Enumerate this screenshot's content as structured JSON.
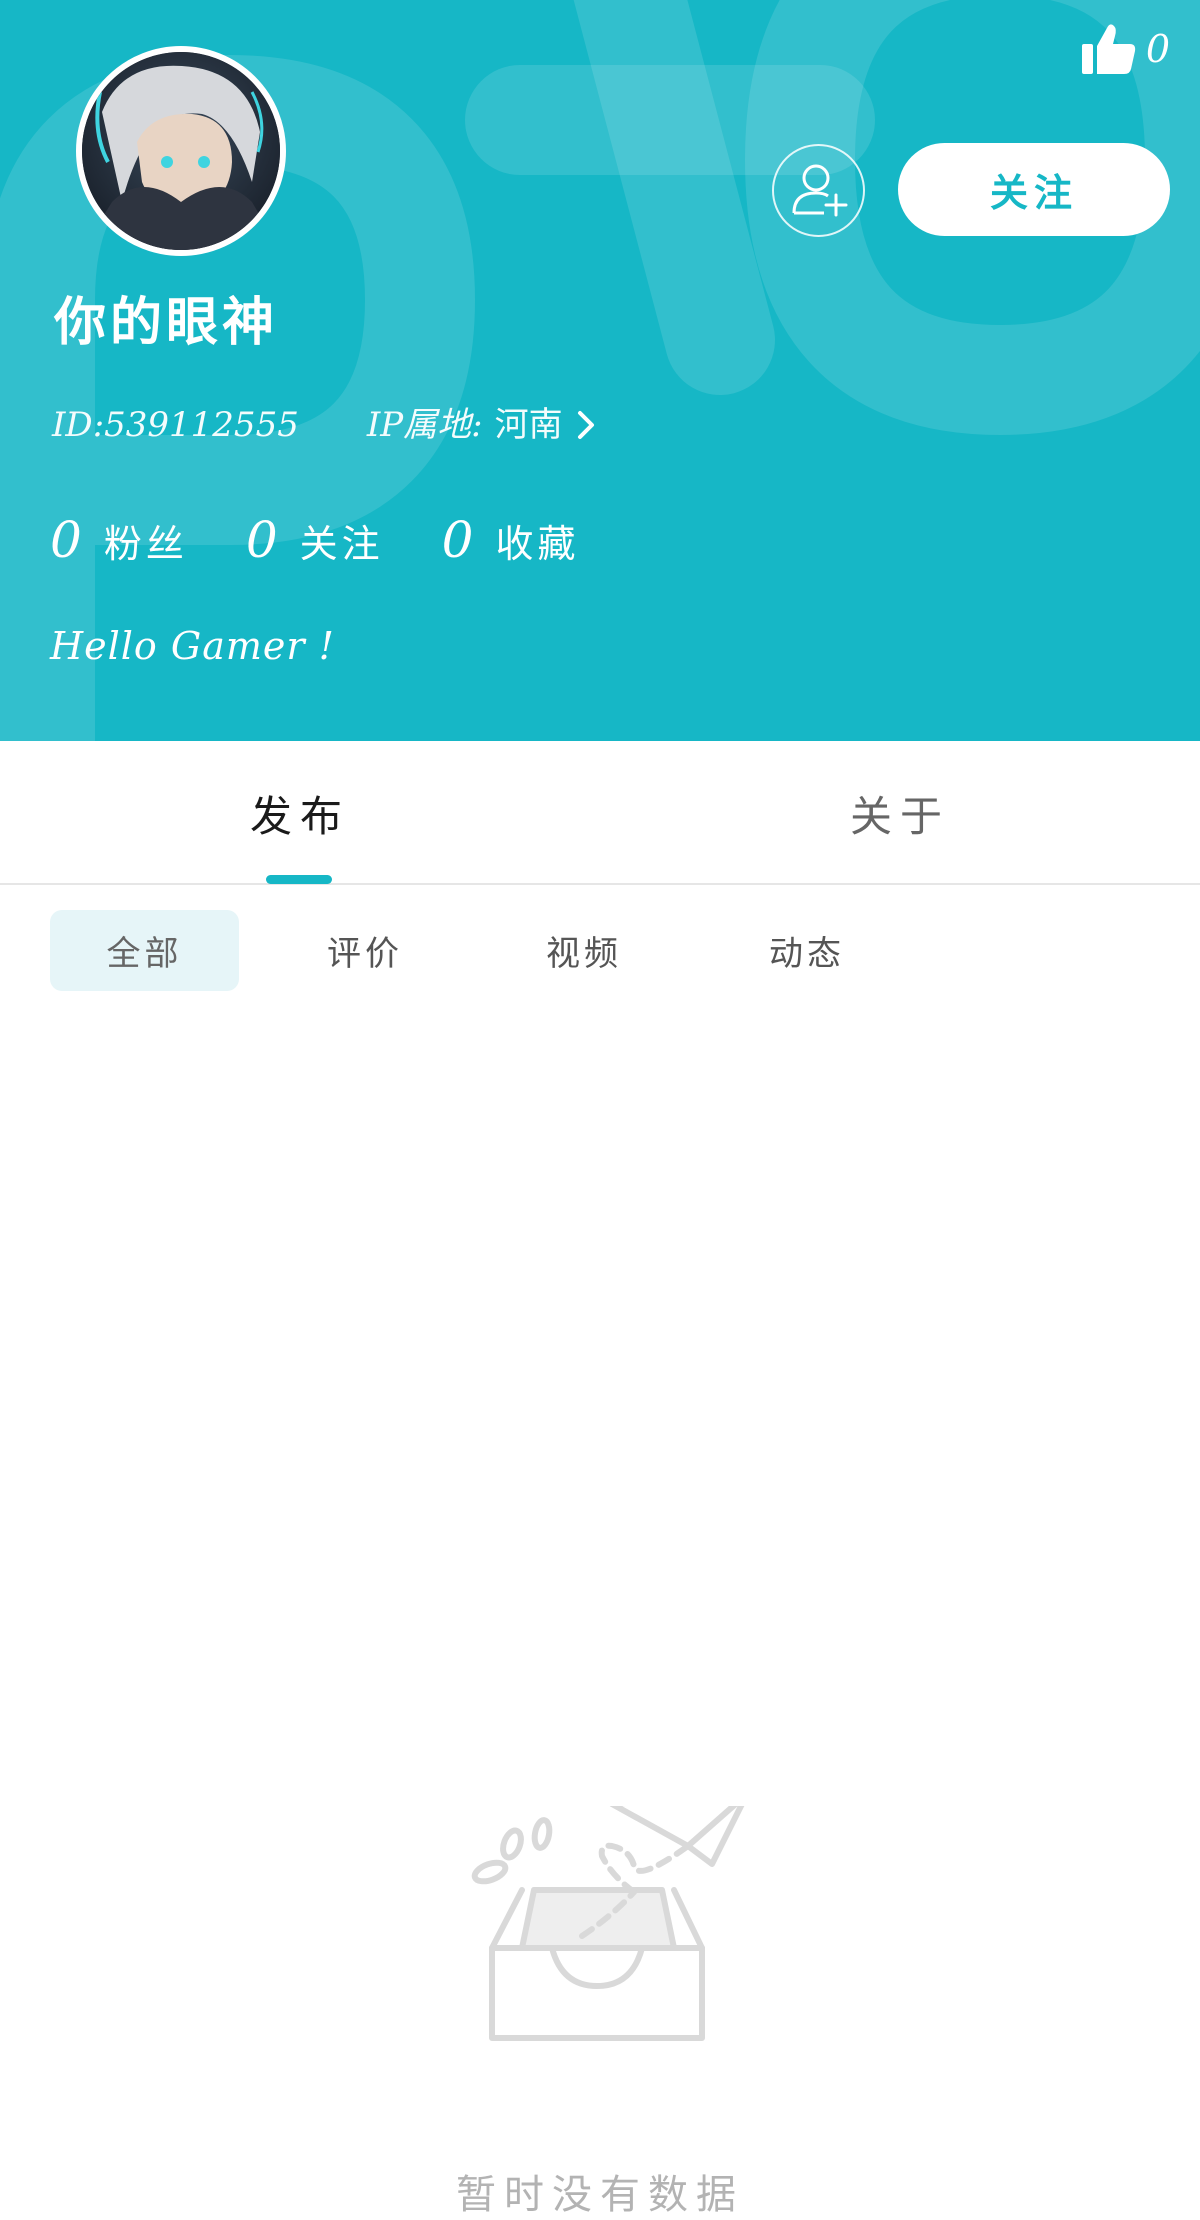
{
  "header": {
    "like_count": "0",
    "follow_label": "关注",
    "username": "你的眼神",
    "user_id": "ID:539112555",
    "ip_label": "IP属地:",
    "ip_location": "河南",
    "stats": [
      {
        "value": "0",
        "label": "粉丝"
      },
      {
        "value": "0",
        "label": "关注"
      },
      {
        "value": "0",
        "label": "收藏"
      }
    ],
    "bio": "Hello Gamer !",
    "accent_color": "#16b7c6"
  },
  "main_tabs": [
    {
      "label": "发布",
      "active": true
    },
    {
      "label": "关于",
      "active": false
    }
  ],
  "sub_tabs": [
    {
      "label": "全部",
      "active": true
    },
    {
      "label": "评价",
      "active": false
    },
    {
      "label": "视频",
      "active": false
    },
    {
      "label": "动态",
      "active": false
    }
  ],
  "empty_state": {
    "icon": "empty-box-paper-plane-icon",
    "message": "暂时没有数据"
  }
}
